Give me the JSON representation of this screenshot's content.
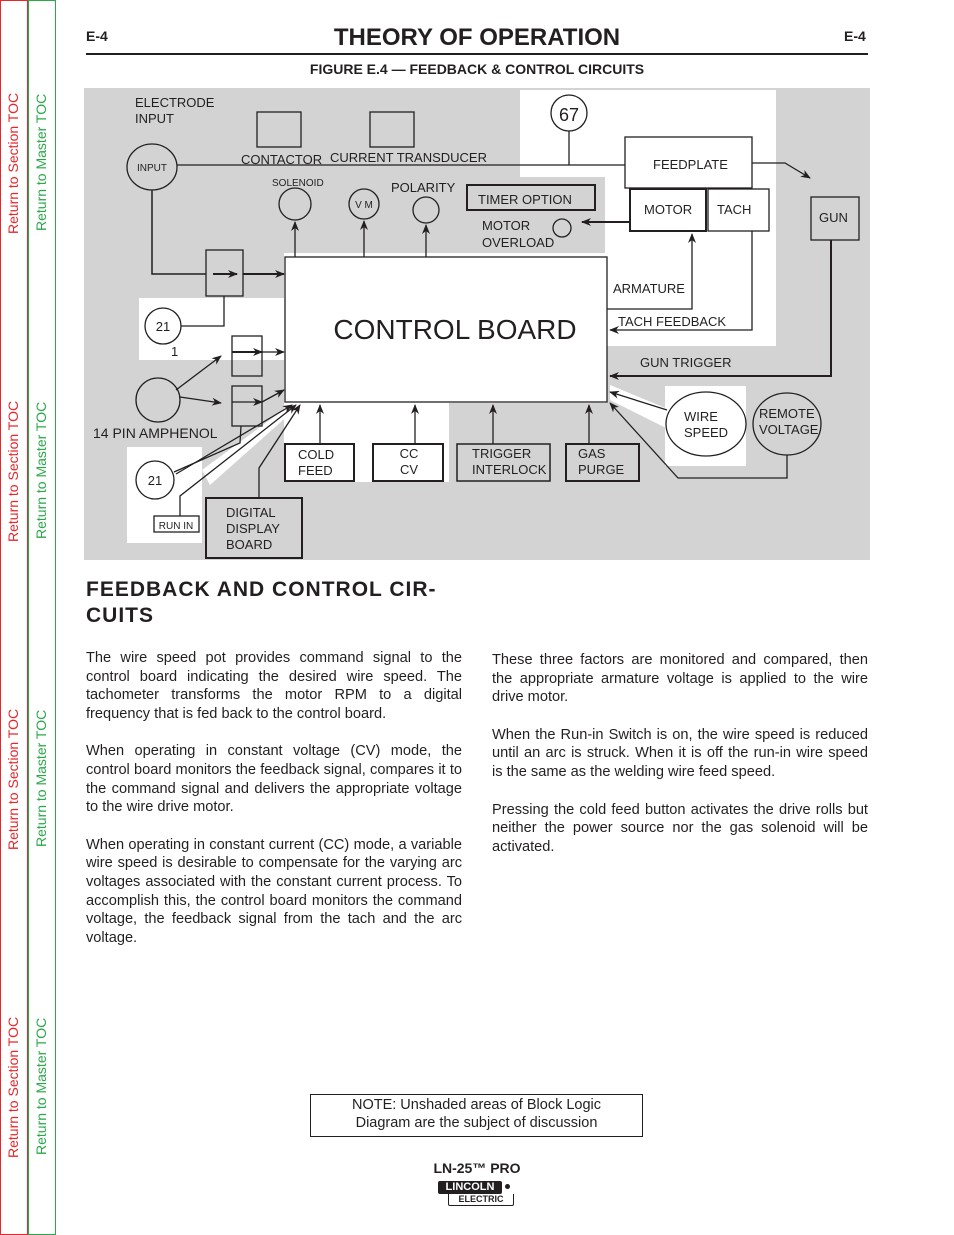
{
  "sidebar": {
    "section_link": "Return to Section TOC",
    "master_link": "Return to Master TOC",
    "colors": {
      "section": "#e8262b",
      "master": "#2aa84a"
    }
  },
  "header": {
    "page_left": "E-4",
    "page_right": "E-4",
    "title": "THEORY OF OPERATION",
    "figure_title": "FIGURE  E.4 — FEEDBACK & CONTROL CIRCUITS"
  },
  "diagram": {
    "electrode_input": [
      "ELECTRODE",
      "INPUT"
    ],
    "input": "INPUT",
    "contactor": "CONTACTOR",
    "current_transducer": "CURRENT TRANSDUCER",
    "node_67": "67",
    "solenoid": "SOLENOID",
    "vm": "V M",
    "polarity": "POLARITY",
    "timer_option": "TIMER OPTION",
    "motor_overload": [
      "MOTOR",
      "OVERLOAD"
    ],
    "feedplate": "FEEDPLATE",
    "motor": "MOTOR",
    "tach": "TACH",
    "gun": "GUN",
    "armature": "ARMATURE",
    "tach_feedback": "TACH FEEDBACK",
    "gun_trigger": "GUN TRIGGER",
    "control_board": "CONTROL BOARD",
    "node_21_top": "21",
    "pin_1": "1",
    "amphenol": "14 PIN AMPHENOL",
    "node_21_bottom": "21",
    "run_in": "RUN IN",
    "digital_display": [
      "DIGITAL",
      "DISPLAY",
      "BOARD"
    ],
    "cold_feed": [
      "COLD",
      "FEED"
    ],
    "cc_cv": [
      "CC",
      "CV"
    ],
    "trigger_interlock": [
      "TRIGGER",
      "INTERLOCK"
    ],
    "gas_purge": [
      "GAS",
      "PURGE"
    ],
    "wire_speed": [
      "WIRE",
      "SPEED"
    ],
    "remote_voltage": [
      "REMOTE",
      "VOLTAGE"
    ],
    "colors": {
      "shaded": "#d3d3d3",
      "unshaded": "#ffffff"
    }
  },
  "section": {
    "heading": "FEEDBACK  AND  CONTROL  CIR-CUITS",
    "left_paragraphs": [
      "The wire speed pot provides command signal to the control board indicating the desired wire speed.  The tachometer transforms the motor RPM to a digital frequency that is fed back to the control board.",
      "When operating in constant voltage (CV) mode, the control board monitors the feedback signal, compares it to the command signal and delivers the  appropriate voltage to the wire drive motor.",
      "When operating in constant current (CC) mode, a variable wire speed is desirable to compensate for the varying arc voltages associated with the constant current process.  To accomplish this, the control board monitors the command voltage, the feedback signal from the tach and the arc voltage."
    ],
    "right_paragraphs": [
      "These three factors are monitored and compared, then the appropriate armature voltage is applied to the wire drive motor.",
      "When  the  Run-in  Switch  is  on,  the  wire  speed  is reduced until an arc is struck.  When it is off the run-in wire speed is the same as the welding wire feed speed.",
      "Pressing the cold feed button activates the drive rolls but neither the power source nor the gas solenoid will be activated."
    ]
  },
  "note": [
    "NOTE: Unshaded areas of Block Logic",
    "Diagram are the subject of discussion"
  ],
  "footer": {
    "model": "LN-25™ PRO",
    "logo_top": "LINCOLN",
    "logo_bottom": "ELECTRIC"
  }
}
